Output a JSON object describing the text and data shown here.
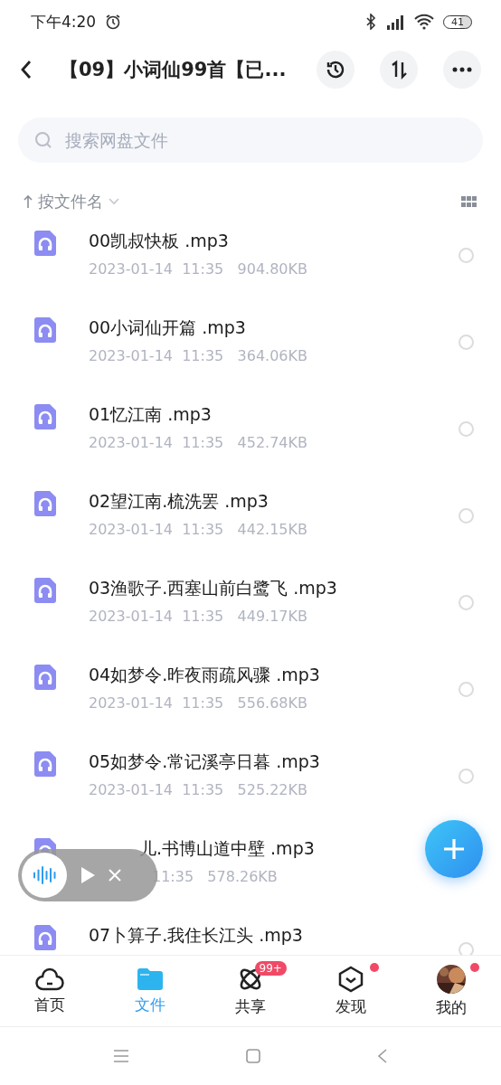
{
  "status_bar": {
    "time": "下午4:20",
    "battery": "41"
  },
  "header": {
    "title": "【09】小词仙99首【已..."
  },
  "search": {
    "placeholder": "搜索网盘文件"
  },
  "sort": {
    "label": "按文件名"
  },
  "files": [
    {
      "name": "00凯叔快板 .mp3",
      "meta": "2023-01-14  11:35   904.80KB",
      "selected": false
    },
    {
      "name": "00小词仙开篇 .mp3",
      "meta": "2023-01-14  11:35   364.06KB",
      "selected": false
    },
    {
      "name": "01忆江南 .mp3",
      "meta": "2023-01-14  11:35   452.74KB",
      "selected": false
    },
    {
      "name": "02望江南.梳洗罢 .mp3",
      "meta": "2023-01-14  11:35   442.15KB",
      "selected": false
    },
    {
      "name": "03渔歌子.西塞山前白鹭飞 .mp3",
      "meta": "2023-01-14  11:35   449.17KB",
      "selected": false
    },
    {
      "name": "04如梦令.昨夜雨疏风骤 .mp3",
      "meta": "2023-01-14  11:35   556.68KB",
      "selected": false
    },
    {
      "name": "05如梦令.常记溪亭日暮 .mp3",
      "meta": "2023-01-14  11:35   525.22KB",
      "selected": false
    },
    {
      "name": "儿.书博山道中壁 .mp3",
      "meta": "11:35   578.26KB",
      "covered": true
    },
    {
      "name": "07卜算子.我住长江头 .mp3",
      "selected": false
    }
  ],
  "nav": [
    {
      "kind": "home",
      "label": "首页",
      "selected": false
    },
    {
      "kind": "files",
      "label": "文件",
      "selected": true
    },
    {
      "kind": "share",
      "label": "共享",
      "selected": false,
      "badge": "99+"
    },
    {
      "kind": "discover",
      "label": "发现",
      "selected": false,
      "dot": true
    },
    {
      "kind": "me",
      "label": "我的",
      "selected": false,
      "dot": true
    }
  ]
}
